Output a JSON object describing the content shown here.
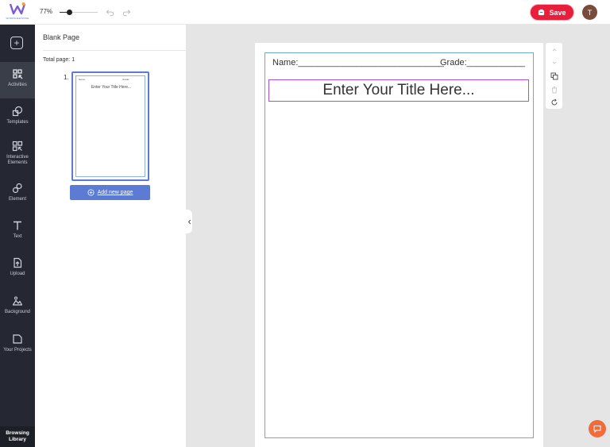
{
  "header": {
    "logo_text": "WORKSHEETZONE",
    "zoom_label": "77%",
    "zoom_level": 0.25,
    "save_label": "Save",
    "avatar_initial": "T",
    "accent_color": "#e91e3a"
  },
  "rail": {
    "items": [
      {
        "label": "Activities",
        "icon": "activities-icon"
      },
      {
        "label": "Templates",
        "icon": "templates-icon"
      },
      {
        "label": "Interactive Elements",
        "icon": "interactive-elements-icon"
      },
      {
        "label": "Element",
        "icon": "element-icon"
      },
      {
        "label": "Text",
        "icon": "text-icon"
      },
      {
        "label": "Upload",
        "icon": "upload-icon"
      },
      {
        "label": "Background",
        "icon": "background-icon"
      },
      {
        "label": "Your Projects",
        "icon": "projects-icon"
      }
    ],
    "bottom_label": "Browsing Library"
  },
  "panel": {
    "title": "Blank Page",
    "total_pages": "Total page: 1",
    "page_number": "1.",
    "thumb_name": "Name:",
    "thumb_grade": "Grade:",
    "thumb_title": "Enter Your Title Here...",
    "add_page_label": "Add new page",
    "button_color": "#5b7bd5"
  },
  "worksheet": {
    "name_line": "Name:______________________________",
    "grade_line": "Grade:____________",
    "title_placeholder": "Enter Your Title Here...",
    "frame_color": "#6aa9d8",
    "selection_color": "#b04be0"
  }
}
